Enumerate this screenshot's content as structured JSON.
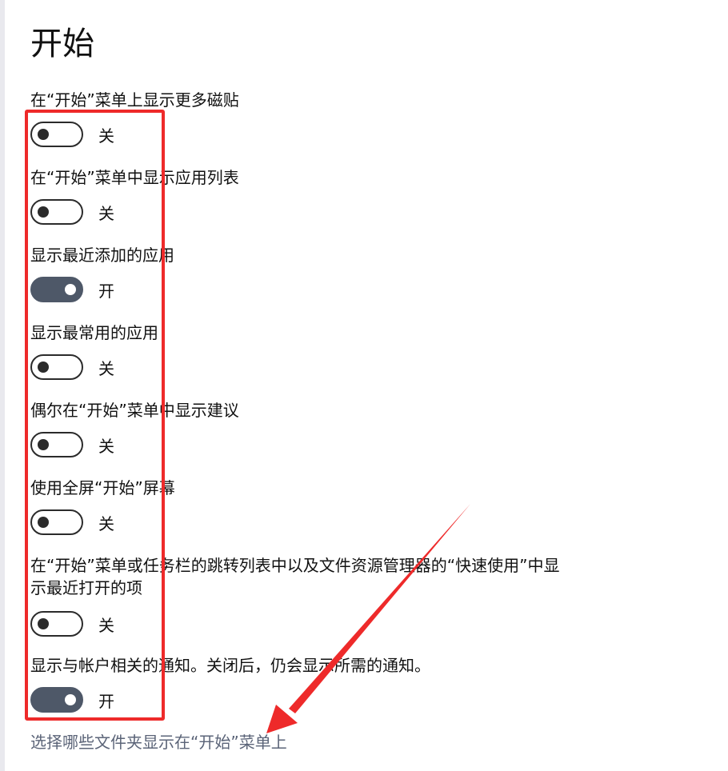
{
  "page": {
    "title": "开始"
  },
  "settings": [
    {
      "label": "在“开始”菜单上显示更多磁贴",
      "state": "关",
      "on": false
    },
    {
      "label": "在“开始”菜单中显示应用列表",
      "state": "关",
      "on": false
    },
    {
      "label": "显示最近添加的应用",
      "state": "开",
      "on": true
    },
    {
      "label": "显示最常用的应用",
      "state": "关",
      "on": false
    },
    {
      "label": "偶尔在“开始”菜单中显示建议",
      "state": "关",
      "on": false
    },
    {
      "label": "使用全屏“开始”屏幕",
      "state": "关",
      "on": false
    },
    {
      "label": "在“开始”菜单或任务栏的跳转列表中以及文件资源管理器的“快速使用”中显示最近打开的项",
      "state": "关",
      "on": false
    },
    {
      "label": "显示与帐户相关的通知。关闭后，仍会显示所需的通知。",
      "state": "开",
      "on": true
    }
  ],
  "links": {
    "choose_folders": "选择哪些文件夹显示在“开始”菜单上"
  },
  "colors": {
    "annotation": "#ee2a2a",
    "toggle_on": "#4e5868",
    "link": "#5b6478"
  }
}
